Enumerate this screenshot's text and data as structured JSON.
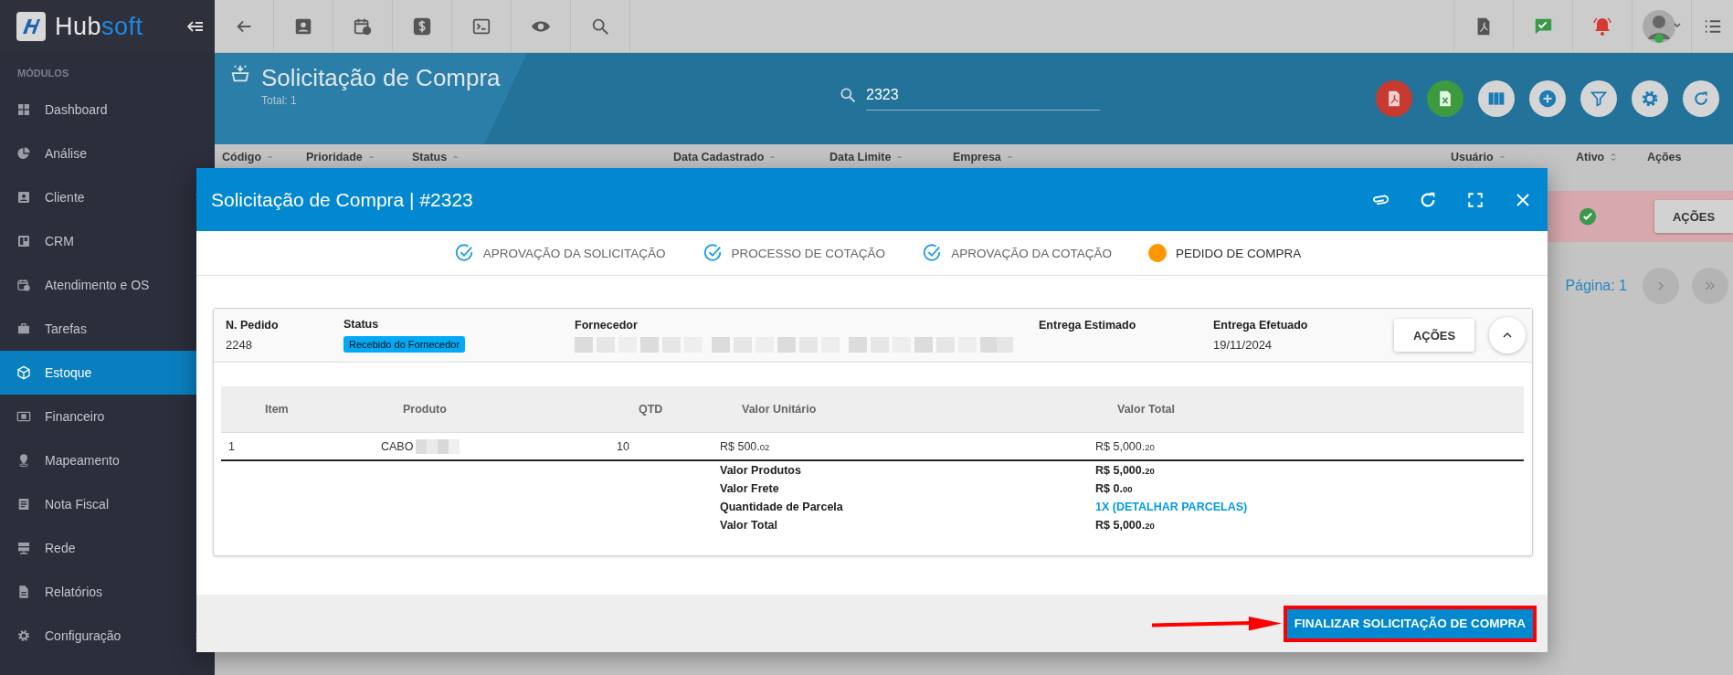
{
  "sidebar": {
    "logo_parts": [
      "Hub",
      "soft"
    ],
    "section_label": "MÓDULOS",
    "items": [
      {
        "label": "Dashboard",
        "selected": false,
        "expandable": false
      },
      {
        "label": "Análise",
        "selected": false,
        "expandable": false
      },
      {
        "label": "Cliente",
        "selected": false,
        "expandable": true
      },
      {
        "label": "CRM",
        "selected": false,
        "expandable": false
      },
      {
        "label": "Atendimento e OS",
        "selected": false,
        "expandable": false
      },
      {
        "label": "Tarefas",
        "selected": false,
        "expandable": false
      },
      {
        "label": "Estoque",
        "selected": true,
        "expandable": false
      },
      {
        "label": "Financeiro",
        "selected": false,
        "expandable": false
      },
      {
        "label": "Mapeamento",
        "selected": false,
        "expandable": false
      },
      {
        "label": "Nota Fiscal",
        "selected": false,
        "expandable": false
      },
      {
        "label": "Rede",
        "selected": false,
        "expandable": false
      },
      {
        "label": "Relatórios",
        "selected": false,
        "expandable": false
      },
      {
        "label": "Configuração",
        "selected": false,
        "expandable": true
      }
    ]
  },
  "page_header": {
    "title": "Solicitação de Compra",
    "total": "Total: 1",
    "search": {
      "value": "2323"
    }
  },
  "table": {
    "columns": [
      {
        "label": "Código",
        "kind": "sort-up"
      },
      {
        "label": "Prioridade",
        "kind": "sort-up"
      },
      {
        "label": "Status",
        "kind": "sort-up"
      },
      {
        "label": "Data Cadastrado",
        "kind": "sort-up"
      },
      {
        "label": "Data Limite",
        "kind": "sort-up"
      },
      {
        "label": "Empresa",
        "kind": "sort-up"
      },
      {
        "label": "Usuário",
        "kind": "sort-up"
      },
      {
        "label": "Ativo",
        "kind": "sort-both"
      },
      {
        "label": "Ações",
        "kind": "plain"
      }
    ],
    "rows": [
      {
        "highlighted": true,
        "active": true,
        "action": "AÇÕES"
      }
    ]
  },
  "pagination": {
    "page": "Página: 1"
  },
  "modal": {
    "title": "Solicitação de Compra | #2323",
    "steps": [
      {
        "label": "APROVAÇÃO DA SOLICITAÇÃO",
        "completed": true
      },
      {
        "label": "PROCESSO DE COTAÇÃO",
        "completed": true
      },
      {
        "label": "APROVAÇÃO DA COTAÇÃO",
        "completed": true
      },
      {
        "label": "PEDIDO DE COMPRA",
        "completed": false
      }
    ],
    "order": {
      "fields": [
        {
          "label": "N. Pedido",
          "kind": "text",
          "value": "2248"
        },
        {
          "label": "Status",
          "kind": "badge",
          "value": "Recebido do Fornecedor"
        },
        {
          "label": "Fornecedor",
          "kind": "redacted"
        },
        {
          "label": "Entrega Estimado",
          "kind": "empty"
        },
        {
          "label": "Entrega Efetuado",
          "kind": "text",
          "value": "19/11/2024"
        }
      ],
      "action": "AÇÕES",
      "expanded": true
    },
    "items": {
      "columns": [
        "Item",
        "Produto",
        "QTD",
        "Valor Unitário",
        "Valor Total"
      ],
      "rows": [
        {
          "item": "1",
          "product": "CABO",
          "product_redacted": true,
          "qty": "10",
          "unit": {
            "main": "R$ 500.",
            "cents": "02"
          },
          "total": {
            "main": "R$ 5,000.",
            "cents": "20"
          }
        }
      ]
    },
    "totals": [
      {
        "label": "Valor Produtos",
        "kind": "amount",
        "value": {
          "main": "R$ 5,000.",
          "cents": "20"
        }
      },
      {
        "label": "Valor Frete",
        "kind": "amount",
        "value": {
          "main": "R$ 0.",
          "cents": "00"
        }
      },
      {
        "label": "Quantidade de Parcela",
        "kind": "link",
        "link": "1X (DETALHAR PARCELAS)"
      },
      {
        "label": "Valor Total",
        "kind": "amount",
        "value": {
          "main": "R$ 5,000.",
          "cents": "20"
        }
      }
    ],
    "footer_button": "FINALIZAR SOLICITAÇÃO DE COMPRA"
  }
}
